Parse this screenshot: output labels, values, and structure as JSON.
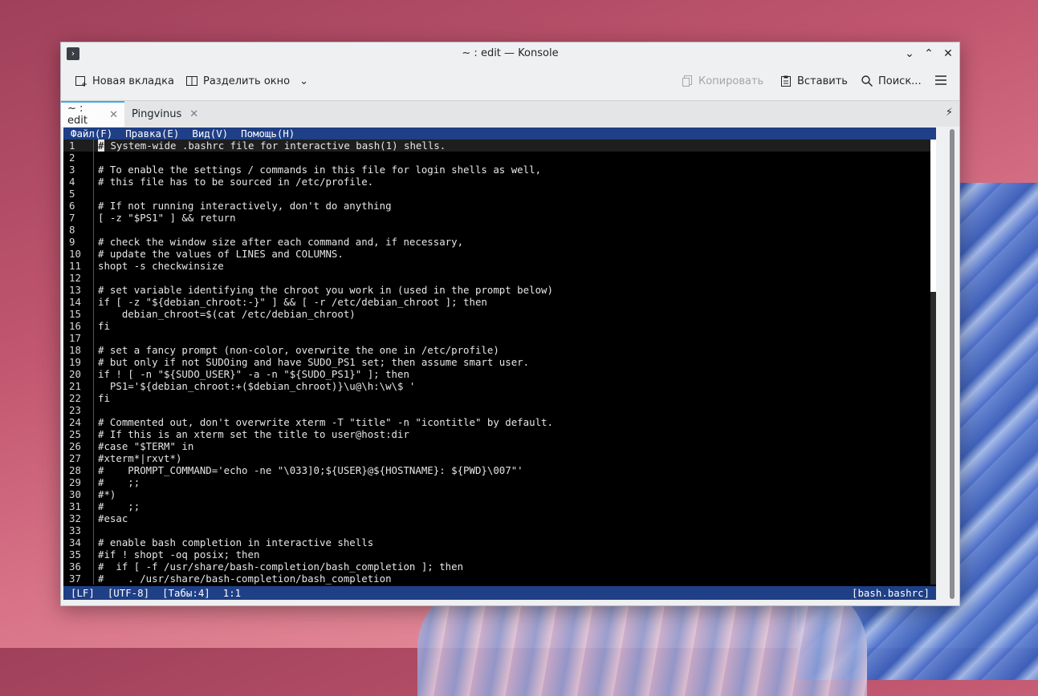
{
  "window": {
    "title": "~ : edit — Konsole"
  },
  "toolbar": {
    "new_tab": "Новая вкладка",
    "split_view": "Разделить окно",
    "copy": "Копировать",
    "paste": "Вставить",
    "find": "Поиск..."
  },
  "tabs": [
    {
      "label": "~ : edit",
      "active": true
    },
    {
      "label": "Pingvinus",
      "active": false
    }
  ],
  "editor": {
    "menu": [
      "Файл(F)",
      "Правка(E)",
      "Вид(V)",
      "Помощь(H)"
    ],
    "lines": [
      "# System-wide .bashrc file for interactive bash(1) shells.",
      "",
      "# To enable the settings / commands in this file for login shells as well,",
      "# this file has to be sourced in /etc/profile.",
      "",
      "# If not running interactively, don't do anything",
      "[ -z \"$PS1\" ] && return",
      "",
      "# check the window size after each command and, if necessary,",
      "# update the values of LINES and COLUMNS.",
      "shopt -s checkwinsize",
      "",
      "# set variable identifying the chroot you work in (used in the prompt below)",
      "if [ -z \"${debian_chroot:-}\" ] && [ -r /etc/debian_chroot ]; then",
      "    debian_chroot=$(cat /etc/debian_chroot)",
      "fi",
      "",
      "# set a fancy prompt (non-color, overwrite the one in /etc/profile)",
      "# but only if not SUDOing and have SUDO_PS1 set; then assume smart user.",
      "if ! [ -n \"${SUDO_USER}\" -a -n \"${SUDO_PS1}\" ]; then",
      "  PS1='${debian_chroot:+($debian_chroot)}\\u@\\h:\\w\\$ '",
      "fi",
      "",
      "# Commented out, don't overwrite xterm -T \"title\" -n \"icontitle\" by default.",
      "# If this is an xterm set the title to user@host:dir",
      "#case \"$TERM\" in",
      "#xterm*|rxvt*)",
      "#    PROMPT_COMMAND='echo -ne \"\\033]0;${USER}@${HOSTNAME}: ${PWD}\\007\"'",
      "#    ;;",
      "#*)",
      "#    ;;",
      "#esac",
      "",
      "# enable bash completion in interactive shells",
      "#if ! shopt -oq posix; then",
      "#  if [ -f /usr/share/bash-completion/bash_completion ]; then",
      "#    . /usr/share/bash-completion/bash_completion"
    ],
    "status": {
      "eol": "[LF]",
      "encoding": "[UTF-8]",
      "tabs": "[Табы:4]",
      "position": "1:1",
      "syntax": "[bash.bashrc]"
    }
  }
}
